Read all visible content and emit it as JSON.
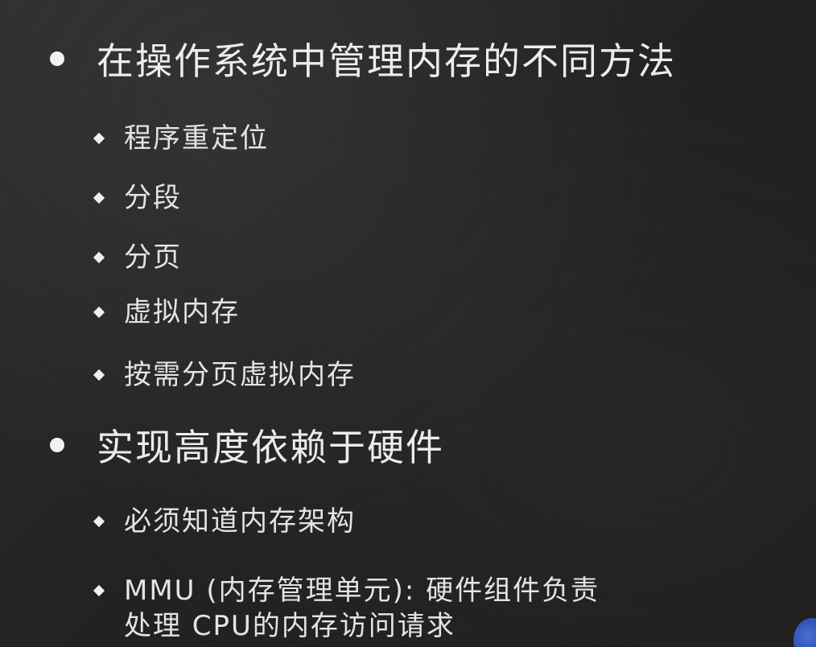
{
  "slide": {
    "bullets": [
      {
        "text": "在操作系统中管理内存的不同方法",
        "sub": [
          "程序重定位",
          "分段",
          "分页",
          "虚拟内存",
          "按需分页虚拟内存"
        ]
      },
      {
        "text": "实现高度依赖于硬件",
        "sub": [
          "必须知道内存架构",
          "MMU (内存管理单元): 硬件组件负责\n处理 CPU的内存访问请求"
        ]
      }
    ]
  }
}
